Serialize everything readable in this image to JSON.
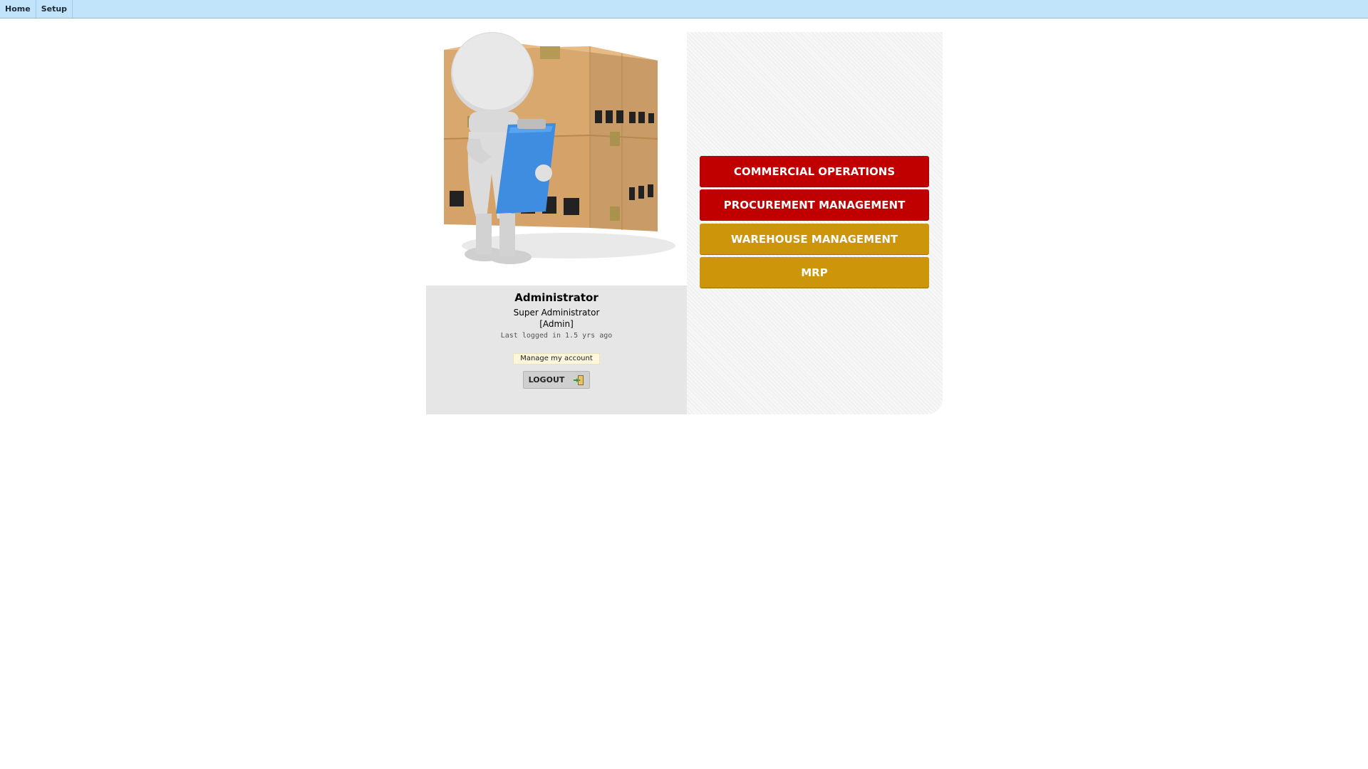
{
  "menu": {
    "items": [
      {
        "label": "Home"
      },
      {
        "label": "Setup"
      }
    ]
  },
  "profile": {
    "name": "Administrator",
    "role": "Super Administrator",
    "login": "[Admin]",
    "last_logged": "Last logged in 1.5 yrs ago",
    "manage_label": "Manage my account",
    "logout_label": "LOGOUT"
  },
  "modules": [
    {
      "label": "COMMERCIAL OPERATIONS",
      "color": "#c00000"
    },
    {
      "label": "PROCUREMENT MANAGEMENT",
      "color": "#c00000"
    },
    {
      "label": "WAREHOUSE MANAGEMENT",
      "color": "#cc950a"
    },
    {
      "label": "MRP",
      "color": "#cc950a"
    }
  ],
  "colors": {
    "topbar": "#c2e4fb",
    "profile_bg": "#e6e6e6",
    "module_red": "#c00000",
    "module_gold": "#cc950a"
  },
  "icons": {
    "illustration": "person-with-clipboard-and-boxes-illustration",
    "logout": "logout-door-icon"
  }
}
